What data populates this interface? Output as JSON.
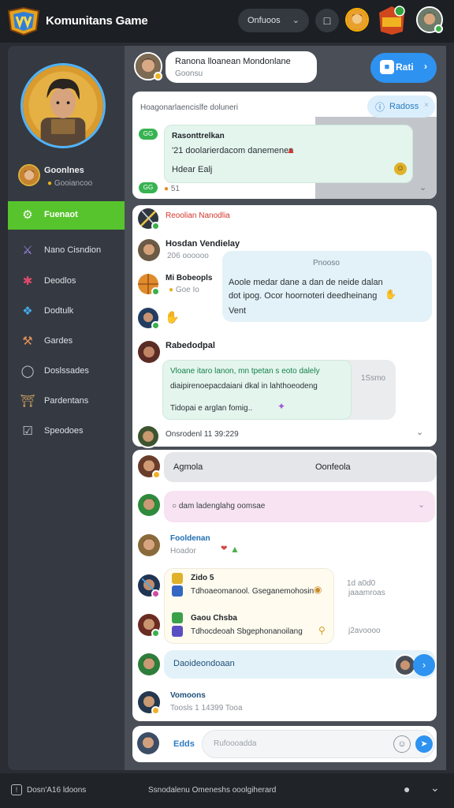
{
  "app": {
    "title": "Komunitans Game",
    "select_value": "Onfuoos"
  },
  "sidebar": {
    "user_name": "Goonlnes",
    "user_status": "Gooiancoo",
    "items": [
      {
        "label": "Fuenaot",
        "icon": "users-icon",
        "active": true
      },
      {
        "label": "Nano Cisndion",
        "icon": "sword-icon"
      },
      {
        "label": "Deodlos",
        "icon": "puzzle-icon"
      },
      {
        "label": "Dodtulk",
        "icon": "bird-icon"
      },
      {
        "label": "Gardes",
        "icon": "hammer-icon"
      },
      {
        "label": "Doslssades",
        "icon": "user-icon"
      },
      {
        "label": "Pardentans",
        "icon": "gate-icon"
      },
      {
        "label": "Speodoes",
        "icon": "checkbox-icon"
      }
    ]
  },
  "header": {
    "title": "Ranona lloanean Mondonlane",
    "sub": "Goonsu",
    "button": "Rati"
  },
  "panel1": {
    "heading": "Hoagonarlaencislfe doluneri",
    "chip": "Radoss",
    "badge1": "GG",
    "badge2": "GG",
    "msg_title": "Rasonttrelkan",
    "msg_line1": "'21 doolarierdacom danemenen",
    "msg_line2": "Hdear Ealj",
    "meta": "51"
  },
  "panel2": {
    "title": "Reoolian Nanodlia",
    "user1": "Hosdan Vendielay",
    "user1_sub": "206 oooooo",
    "blue_label": "Pnooso",
    "blue_line1": "Aoole medar dane a dan de neide dalan",
    "blue_line2": "dot ipog. Ocor hoornoteri deedheinang",
    "blue_line3": "Vent",
    "user2": "Mi Bobeopls",
    "user2_sub": "Goe Io",
    "user3": "Rabedodpal",
    "green_line1": "Vloane itaro lanon, mn tpetan s eoto dalely",
    "green_line2": "diaipirenoepacdaiani dkal in lahthoeodeng",
    "green_line3": "Tidopai e arglan fomig..",
    "side_meta": "1Ssmo",
    "footer": "Onsrodenl 11 39:229"
  },
  "panel3": {
    "tab1": "Agmola",
    "tab2": "Oonfeola",
    "search": "dam ladenglahg oomsae",
    "item1_name": "Fooldenan",
    "item1_sub": "Hoador",
    "item2_name": "Zido 5",
    "item2_line": "Tdhoaeomanool. Gseganemohosin",
    "item2_meta1": "1d a0d0",
    "item2_meta2": "jaaamroas",
    "item3_name": "Gaou Chsba",
    "item3_line": "Tdhocdeoah Sbgephonanoilang",
    "item3_meta": "j2avoooo",
    "item4_name": "Daoideondoaan",
    "item5_name": "Vomoons",
    "item5_sub": "Toosls 1 14399 Tooa",
    "input_label": "Edds",
    "input_placeholder": "Rufoooadda"
  },
  "bottom": {
    "left": "Dosn'A16 ldoons",
    "center": "Ssnodalenu Omeneshs ooolgiherard"
  },
  "colors": {
    "accent_green": "#57c42d",
    "accent_blue": "#2e92f0",
    "sidebar_bg": "#353941",
    "topbar_bg": "#1c1f24"
  }
}
